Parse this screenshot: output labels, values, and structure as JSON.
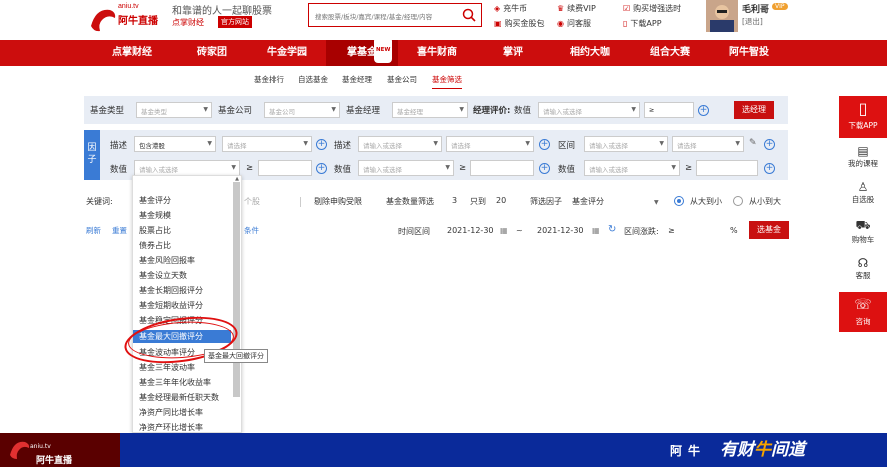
{
  "header": {
    "logo_en": "aniu.tv",
    "logo_cn": "阿牛直播",
    "slogan": "和靠谱的人一起聊股票",
    "sub_brand": "点掌财经",
    "official_tag": "官方网站",
    "search_placeholder": "搜索股票/板块/嘉宾/课程/基金/经理/内容",
    "quick_links": [
      "充牛币",
      "续费VIP",
      "购买增强选时",
      "购买金股包",
      "问客服",
      "下载APP"
    ],
    "user_name": "毛利哥",
    "vip_badge": "VIP",
    "logout": "[退出]"
  },
  "nav": {
    "items": [
      "点掌财经",
      "砖家团",
      "牛金学园",
      "掌基金",
      "喜牛财商",
      "掌评",
      "相约大咖",
      "组合大赛",
      "阿牛智投"
    ],
    "new_badge": "NEW",
    "active": "掌基金"
  },
  "subnav": [
    "基金排行",
    "自选基金",
    "基金经理",
    "基金公司",
    "基金筛选"
  ],
  "filter1": {
    "fund_type_label": "基金类型",
    "fund_type_ph": "基金类型",
    "company_label": "基金公司",
    "company_ph": "基金公司",
    "manager_label": "基金经理",
    "manager_ph": "基金经理",
    "rating_label": "经理评价:",
    "value_label": "数值",
    "value_ph": "请输入或选择",
    "ge": "≥",
    "select_btn": "选经理"
  },
  "filter2": {
    "side_label": "因子",
    "desc_label": "描述",
    "desc_value": "包含港股",
    "value_label": "数值",
    "select_ph": "请选择",
    "input_ph": "请输入或选择",
    "interval_label": "区间",
    "ge": "≥"
  },
  "row3": {
    "keyword_label": "关键词:",
    "stock_count": "个股",
    "exclude": "剔除申购受限",
    "count_label": "基金数量筛选",
    "count_value": "3",
    "only_label": "只到",
    "only_value": "20",
    "factor_label": "筛选因子",
    "factor_value": "基金评分",
    "sort_desc": "从大到小",
    "sort_asc": "从小到大"
  },
  "row4": {
    "refresh": "刷新",
    "reset": "重置",
    "conditions": "条件",
    "time_label": "时间区间",
    "date_from": "2021-12-30",
    "tilde": "~",
    "date_to": "2021-12-30",
    "change_label": "区间涨跌:",
    "ge": "≥",
    "percent": "%",
    "select_btn": "选基金"
  },
  "dropdown": {
    "items": [
      "基金评分",
      "基金规模",
      "股票占比",
      "债券占比",
      "基金风险回报率",
      "基金设立天数",
      "基金长期回报评分",
      "基金短期收益评分",
      "基金稳定回报评分",
      "基金最大回撤评分",
      "基金波动率评分",
      "基金三年波动率",
      "基金三年年化收益率",
      "基金经理最新任职天数",
      "净资产同比增长率",
      "净资产环比增长率"
    ],
    "highlighted_index": 9,
    "tooltip": "基金最大回撤评分"
  },
  "sidebar": {
    "items": [
      "下载APP",
      "我的课程",
      "自选股",
      "购物车",
      "客服",
      "咨询"
    ]
  },
  "footer": {
    "brand_en": "aniu.tv",
    "brand": "阿牛直播",
    "aniu": "阿牛",
    "slogan_left": "有财",
    "slogan_mid": "牛",
    "slogan_right": "间道"
  },
  "colors": {
    "brand_red": "#cc0d0d",
    "accent_blue": "#3a7bd5",
    "footer_blue": "#0a2a9a"
  }
}
